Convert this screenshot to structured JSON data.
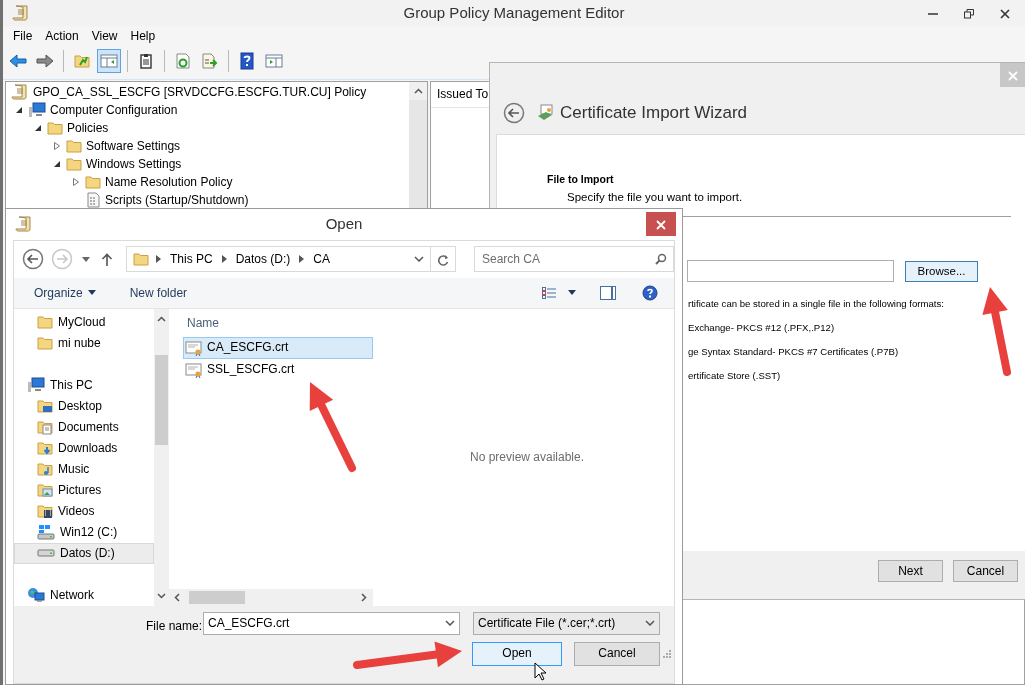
{
  "window": {
    "title": "Group Policy Management Editor"
  },
  "menu": [
    "File",
    "Action",
    "View",
    "Help"
  ],
  "toolbar": [
    {
      "kind": "back",
      "pressed": false
    },
    {
      "kind": "forward",
      "pressed": false
    },
    {
      "kind": "separator"
    },
    {
      "kind": "up",
      "pressed": false
    },
    {
      "kind": "console-tree",
      "pressed": true
    },
    {
      "kind": "separator"
    },
    {
      "kind": "properties",
      "pressed": false
    },
    {
      "kind": "separator"
    },
    {
      "kind": "refresh",
      "pressed": false
    },
    {
      "kind": "export",
      "pressed": false
    },
    {
      "kind": "separator"
    },
    {
      "kind": "help",
      "pressed": false
    },
    {
      "kind": "action-pane",
      "pressed": false
    }
  ],
  "tree": [
    {
      "label": "GPO_CA_SSL_ESCFG [SRVDCCFG.ESCFG.TUR.CU] Policy",
      "kind": "policy",
      "children": [
        {
          "label": "Computer Configuration",
          "kind": "computer",
          "expanded": true,
          "children": [
            {
              "label": "Policies",
              "kind": "folder",
              "expanded": true,
              "children": [
                {
                  "label": "Software Settings",
                  "kind": "folder",
                  "expanded": false
                },
                {
                  "label": "Windows Settings",
                  "kind": "folder",
                  "expanded": true,
                  "children": [
                    {
                      "label": "Name Resolution Policy",
                      "kind": "folder",
                      "expanded": false
                    },
                    {
                      "label": "Scripts (Startup/Shutdown)",
                      "kind": "script"
                    }
                  ]
                }
              ]
            }
          ]
        }
      ]
    }
  ],
  "details": {
    "columns": [
      "Issued To"
    ]
  },
  "wizard": {
    "title": "Certificate Import Wizard",
    "heading": "File to Import",
    "subheading": "Specify the file you want to import.",
    "browse_button": "Browse...",
    "info_lines": [
      "rtificate can be stored in a single file in the following formats:",
      "Exchange- PKCS #12 (.PFX,.P12)",
      "ge Syntax Standard- PKCS #7 Certificates (.P7B)",
      "ertificate Store (.SST)"
    ],
    "buttons": [
      "Next",
      "Cancel"
    ]
  },
  "open_dialog": {
    "title": "Open",
    "breadcrumb": [
      "This PC",
      "Datos (D:)",
      "CA"
    ],
    "search_placeholder": "Search CA",
    "commands": [
      "Organize",
      "New folder"
    ],
    "nav_tree": [
      {
        "children": [
          {
            "label": "MyCloud",
            "kind": "folder",
            "selected": false
          },
          {
            "label": "mi nube",
            "kind": "folder",
            "selected": false
          }
        ]
      },
      {
        "label": "This PC",
        "kind": "pc",
        "selected": false,
        "children": [
          {
            "label": "Desktop",
            "kind": "desktop",
            "selected": false
          },
          {
            "label": "Documents",
            "kind": "documents",
            "selected": false
          },
          {
            "label": "Downloads",
            "kind": "downloads",
            "selected": false
          },
          {
            "label": "Music",
            "kind": "music",
            "selected": false
          },
          {
            "label": "Pictures",
            "kind": "pictures",
            "selected": false
          },
          {
            "label": "Videos",
            "kind": "videos",
            "selected": false
          },
          {
            "label": "Win12 (C:)",
            "kind": "windows-drive",
            "selected": false
          },
          {
            "label": "Datos (D:)",
            "kind": "drive",
            "selected": true
          }
        ]
      },
      {
        "label": "Network",
        "kind": "network",
        "selected": false
      }
    ],
    "file_column": "Name",
    "files": [
      {
        "name": "CA_ESCFG.crt",
        "selected": true
      },
      {
        "name": "SSL_ESCFG.crt",
        "selected": false
      }
    ],
    "preview_text": "No preview available.",
    "file_name_label": "File name:",
    "file_name": "CA_ESCFG.crt",
    "filter": "Certificate File (*.cer;*.crt)",
    "buttons": [
      "Open",
      "Cancel"
    ]
  }
}
